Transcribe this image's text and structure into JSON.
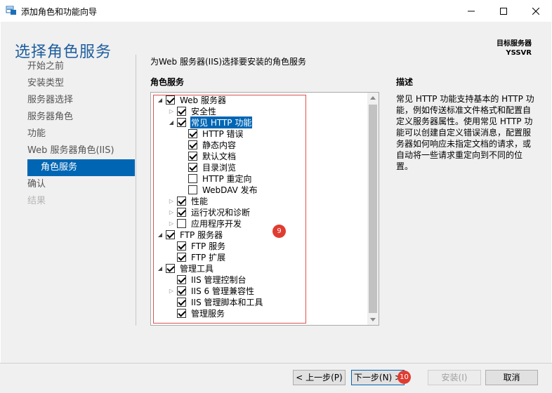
{
  "window": {
    "title": "添加角色和功能向导"
  },
  "header": {
    "title": "选择角色服务",
    "target_label": "目标服务器",
    "target_value": "YSSVR"
  },
  "nav": {
    "items": [
      {
        "label": "开始之前"
      },
      {
        "label": "安装类型"
      },
      {
        "label": "服务器选择"
      },
      {
        "label": "服务器角色"
      },
      {
        "label": "功能"
      },
      {
        "label": "Web 服务器角色(IIS)"
      },
      {
        "label": "角色服务"
      },
      {
        "label": "确认"
      },
      {
        "label": "结果"
      }
    ]
  },
  "content": {
    "heading": "为Web 服务器(IIS)选择要安装的角色服务",
    "services_label": "角色服务"
  },
  "tree": {
    "items": [
      {
        "label": "Web 服务器",
        "expander": "expanded",
        "checked": true
      },
      {
        "label": "安全性",
        "expander": "collapsed",
        "checked": true
      },
      {
        "label": "常见 HTTP 功能",
        "expander": "expanded",
        "checked": true,
        "selected": true
      },
      {
        "label": "HTTP 错误",
        "expander": "none",
        "checked": true
      },
      {
        "label": "静态内容",
        "expander": "none",
        "checked": true
      },
      {
        "label": "默认文档",
        "expander": "none",
        "checked": true
      },
      {
        "label": "目录浏览",
        "expander": "none",
        "checked": true
      },
      {
        "label": "HTTP 重定向",
        "expander": "none",
        "checked": false
      },
      {
        "label": "WebDAV 发布",
        "expander": "none",
        "checked": false
      },
      {
        "label": "性能",
        "expander": "collapsed",
        "checked": true
      },
      {
        "label": "运行状况和诊断",
        "expander": "collapsed",
        "checked": true
      },
      {
        "label": "应用程序开发",
        "expander": "collapsed",
        "checked": false
      },
      {
        "label": "FTP 服务器",
        "expander": "expanded",
        "checked": true
      },
      {
        "label": "FTP 服务",
        "expander": "none",
        "checked": true
      },
      {
        "label": "FTP 扩展",
        "expander": "none",
        "checked": true
      },
      {
        "label": "管理工具",
        "expander": "expanded",
        "checked": true
      },
      {
        "label": "IIS 管理控制台",
        "expander": "none",
        "checked": true
      },
      {
        "label": "IIS 6 管理兼容性",
        "expander": "collapsed",
        "checked": true
      },
      {
        "label": "IIS 管理脚本和工具",
        "expander": "none",
        "checked": true
      },
      {
        "label": "管理服务",
        "expander": "none",
        "checked": true
      }
    ]
  },
  "description": {
    "title": "描述",
    "text": "常见 HTTP 功能支持基本的 HTTP 功能，例如传送标准文件格式和配置自定义服务器属性。使用常见 HTTP 功能可以创建自定义错误消息，配置服务器如何响应未指定文档的请求，或自动将一些请求重定向到不同的位置。"
  },
  "annotations": {
    "tree_badge": "9",
    "next_badge": "10"
  },
  "buttons": {
    "prev": "< 上一步(P)",
    "next": "下一步(N) >",
    "install": "安装(I)",
    "cancel": "取消"
  },
  "colors": {
    "accent": "#0066b4",
    "title": "#1e5e9e",
    "badge": "#e03c31",
    "highlight_border": "#d9534f"
  }
}
